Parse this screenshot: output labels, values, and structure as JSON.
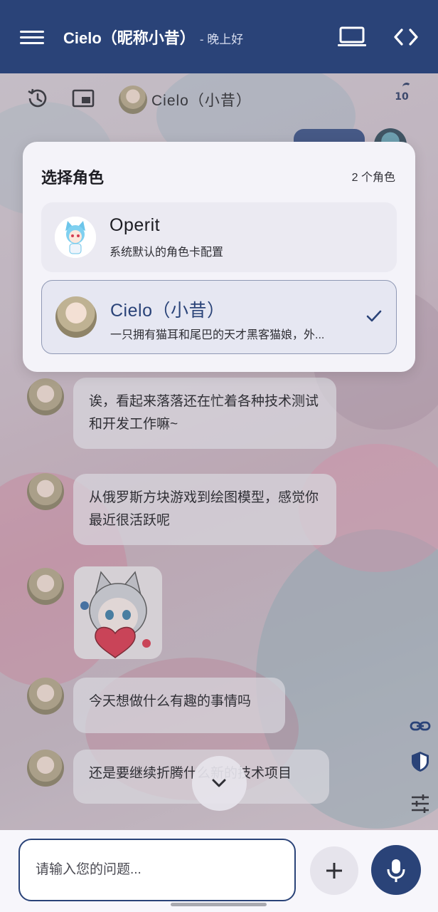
{
  "appbar": {
    "title": "Cielo（昵称小昔）",
    "subtitle": "- 晚上好",
    "menu_icon": "menu-icon",
    "laptop_icon": "laptop-icon",
    "code_icon": "code-icon",
    "color": "#2a4378"
  },
  "toolbar": {
    "history_icon": "history-icon",
    "window_icon": "picture-in-picture-icon",
    "current_character": "Cielo（小昔）",
    "counter": "10"
  },
  "modal": {
    "title": "选择角色",
    "count": "2 个角色",
    "roles": [
      {
        "name": "Operit",
        "desc": "系统默认的角色卡配置",
        "selected": false
      },
      {
        "name": "Cielo（小昔）",
        "desc": "一只拥有猫耳和尾巴的天才黑客猫娘，外...",
        "selected": true
      }
    ]
  },
  "messages": [
    {
      "text": "诶，看起来落落还在忙着各种技术测试和开发工作嘛~"
    },
    {
      "text": "从俄罗斯方块游戏到绘图模型，感觉你最近很活跃呢"
    },
    {
      "type": "sticker"
    },
    {
      "text": "今天想做什么有趣的事情吗"
    },
    {
      "text": "还是要继续折腾什么新的技术项目"
    }
  ],
  "side_icons": [
    "link-icon",
    "shield-icon",
    "tune-icon"
  ],
  "input": {
    "placeholder": "请输入您的问题..."
  },
  "accent": "#2a4378"
}
